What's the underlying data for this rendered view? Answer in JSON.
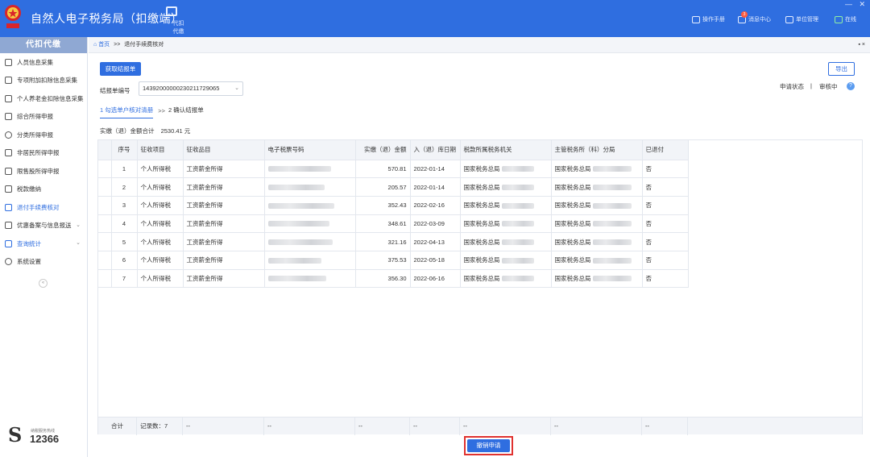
{
  "header": {
    "app_title": "自然人电子税务局（扣缴端）",
    "tab_label": "代扣代缴",
    "manual": "操作手册",
    "messages": "消息中心",
    "message_badge": "3",
    "unit_mgmt": "单位管理",
    "online": "在线",
    "minimize": "—",
    "close": "✕"
  },
  "sidebar": {
    "title": "代扣代缴",
    "items": [
      {
        "label": "人员信息采集"
      },
      {
        "label": "专项附加扣除信息采集"
      },
      {
        "label": "个人养老金扣除信息采集"
      },
      {
        "label": "综合所得申报"
      },
      {
        "label": "分类所得申报"
      },
      {
        "label": "非居民所得申报"
      },
      {
        "label": "限售股所得申报"
      },
      {
        "label": "税款缴纳"
      },
      {
        "label": "退付手续费核对"
      },
      {
        "label": "优惠备案与信息报送"
      },
      {
        "label": "查询统计"
      },
      {
        "label": "系统设置"
      }
    ],
    "collapse": "«",
    "hotline_label": "纳税服务热线",
    "hotline_number": "12366"
  },
  "breadcrumb": {
    "home": "首页",
    "sep": ">>",
    "current": "退付手续费核对",
    "controls": "▪ ×"
  },
  "toolbar": {
    "fetch_button": "获取结报单",
    "export_button": "导出"
  },
  "form": {
    "settlement_label": "结报单编号",
    "settlement_value": "14392000000230211729065",
    "status_label": "申请状态",
    "status_sep": "|",
    "status_value": "审核中",
    "help": "?"
  },
  "steps": {
    "step1": "1 勾选单户核对清册",
    "sep": ">>",
    "step2": "2 确认结报单"
  },
  "total": {
    "label": "实缴（退）金额合计",
    "value": "2530.41 元"
  },
  "table": {
    "headers": [
      "序号",
      "征收项目",
      "征收品目",
      "电子税票号码",
      "实缴（退）金额",
      "入（退）库日期",
      "税款所属税务机关",
      "主管税务所（科）分局",
      "已退付"
    ],
    "rows": [
      {
        "no": "1",
        "item": "个人所得税",
        "subitem": "工资薪金所得",
        "amount": "570.81",
        "date": "2022-01-14",
        "authority": "国家税务总局",
        "branch": "国家税务总局",
        "refunded": "否"
      },
      {
        "no": "2",
        "item": "个人所得税",
        "subitem": "工资薪金所得",
        "amount": "205.57",
        "date": "2022-01-14",
        "authority": "国家税务总局",
        "branch": "国家税务总局",
        "refunded": "否"
      },
      {
        "no": "3",
        "item": "个人所得税",
        "subitem": "工资薪金所得",
        "amount": "352.43",
        "date": "2022-02-16",
        "authority": "国家税务总局",
        "branch": "国家税务总局",
        "refunded": "否"
      },
      {
        "no": "4",
        "item": "个人所得税",
        "subitem": "工资薪金所得",
        "amount": "348.61",
        "date": "2022-03-09",
        "authority": "国家税务总局",
        "branch": "国家税务总局",
        "refunded": "否"
      },
      {
        "no": "5",
        "item": "个人所得税",
        "subitem": "工资薪金所得",
        "amount": "321.16",
        "date": "2022-04-13",
        "authority": "国家税务总局",
        "branch": "国家税务总局",
        "refunded": "否"
      },
      {
        "no": "6",
        "item": "个人所得税",
        "subitem": "工资薪金所得",
        "amount": "375.53",
        "date": "2022-05-18",
        "authority": "国家税务总局",
        "branch": "国家税务总局",
        "refunded": "否"
      },
      {
        "no": "7",
        "item": "个人所得税",
        "subitem": "工资薪金所得",
        "amount": "356.30",
        "date": "2022-06-16",
        "authority": "国家税务总局",
        "branch": "国家税务总局",
        "refunded": "否"
      }
    ],
    "footer": {
      "total_label": "合计",
      "count_label": "记录数：7",
      "dash": "--"
    }
  },
  "actions": {
    "cancel_button": "撤销申请"
  },
  "colors": {
    "brand": "#2f6ee0",
    "highlight_border": "#e0322f"
  }
}
